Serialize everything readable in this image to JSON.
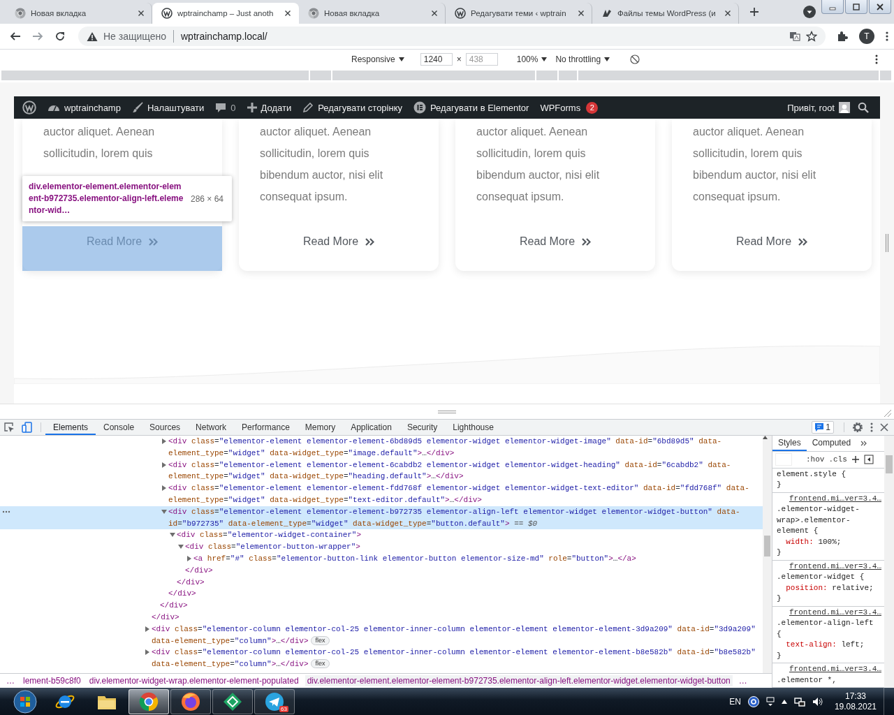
{
  "browser_tabs": [
    {
      "title": "Новая вкладка",
      "kind": "chrome",
      "selected": false
    },
    {
      "title": "wptrainchamp – Just anoth",
      "kind": "wordpress",
      "selected": true
    },
    {
      "title": "Новая вкладка",
      "kind": "chrome",
      "selected": false
    },
    {
      "title": "Редагувати теми ‹ wptrain",
      "kind": "wordpress",
      "selected": false
    },
    {
      "title": "Файлы темы WordPress (и",
      "kind": "quill",
      "selected": false
    }
  ],
  "address_bar": {
    "security": "Не защищено",
    "url": "wptrainchamp.local/",
    "profile": "T"
  },
  "device_toolbar": {
    "mode": "Responsive",
    "width_field": {
      "value": "1240"
    },
    "times": "×",
    "height_field": {
      "placeholder": "438"
    },
    "zoom": "100%",
    "throttling": "No throttling"
  },
  "admin_bar": {
    "items": [
      {
        "kind": "wordpress"
      },
      {
        "kind": "dashboard",
        "label": "wptrainchamp"
      },
      {
        "kind": "brush",
        "label": "Налаштувати"
      },
      {
        "kind": "comment",
        "label": "0"
      },
      {
        "kind": "plus",
        "label": "Додати"
      },
      {
        "kind": "pencil",
        "label": "Редагувати сторінку"
      },
      {
        "kind": "elementor",
        "label": "Редагувати в Elementor"
      },
      {
        "kind": "text",
        "label": "WPForms",
        "badge": "2"
      }
    ],
    "greeting": "Привіт, root"
  },
  "cards": [
    {
      "lines": [
        "auctor aliquet. Aenean",
        "sollicitudin, lorem quis"
      ],
      "button": "Read More",
      "highlighted": true
    },
    {
      "lines": [
        "auctor aliquet. Aenean",
        "sollicitudin, lorem quis",
        "bibendum auctor, nisi elit",
        "consequat ipsum."
      ],
      "button": "Read More",
      "highlighted": false
    },
    {
      "lines": [
        "auctor aliquet. Aenean",
        "sollicitudin, lorem quis",
        "bibendum auctor, nisi elit",
        "consequat ipsum."
      ],
      "button": "Read More",
      "highlighted": false
    },
    {
      "lines": [
        "auctor aliquet. Aenean",
        "sollicitudin, lorem quis",
        "bibendum auctor, nisi elit",
        "consequat ipsum."
      ],
      "button": "Read More",
      "highlighted": false
    }
  ],
  "inspect_tooltip": {
    "selector": "div.elementor-element.elementor-element-b972735.elementor-align-left.elementor-wid…",
    "size": "286 × 64"
  },
  "devtools": {
    "tabs": [
      {
        "label": "Elements",
        "selected": true
      },
      {
        "label": "Console",
        "selected": false
      },
      {
        "label": "Sources",
        "selected": false
      },
      {
        "label": "Network",
        "selected": false
      },
      {
        "label": "Performance",
        "selected": false
      },
      {
        "label": "Memory",
        "selected": false
      },
      {
        "label": "Application",
        "selected": false
      },
      {
        "label": "Security",
        "selected": false
      },
      {
        "label": "Lighthouse",
        "selected": false
      }
    ],
    "issues": "1",
    "dom_tree": [
      {
        "kind": "partial",
        "close": "</div>",
        "children": [
          {
            "kind": "partial",
            "close": "</div>",
            "children": [
              {
                "kind": "element",
                "tag": "<div class=\"elementor-element elementor-element-6bd89d5 elementor-widget elementor-widget-image\" data-id=\"6bd89d5\" data-element_type=\"widget\" data-widget_type=\"image.default\">…</div>",
                "expanded": false,
                "selected": false
              },
              {
                "kind": "element",
                "tag": "<div class=\"elementor-element elementor-element-6cabdb2 elementor-widget elementor-widget-heading\" data-id=\"6cabdb2\" data-element_type=\"widget\" data-widget_type=\"heading.default\">…</div>",
                "expanded": false,
                "selected": false
              },
              {
                "kind": "element",
                "tag": "<div class=\"elementor-element elementor-element-fdd768f elementor-widget elementor-widget-text-editor\" data-id=\"fdd768f\" data-element_type=\"widget\" data-widget_type=\"text-editor.default\">…</div>",
                "expanded": false,
                "selected": false
              },
              {
                "kind": "element",
                "tag": "<div class=\"elementor-element elementor-element-b972735 elementor-align-left elementor-widget elementor-widget-button\" data-id=\"b972735\" data-element_type=\"widget\" data-widget_type=\"button.default\">",
                "suffix": "== $0",
                "expanded": true,
                "selected": true,
                "close": "</div>",
                "children": [
                  {
                    "kind": "element",
                    "tag": "<div class=\"elementor-widget-container\">",
                    "expanded": true,
                    "selected": false,
                    "close": "</div>",
                    "children": [
                      {
                        "kind": "element",
                        "tag": "<div class=\"elementor-button-wrapper\">",
                        "expanded": true,
                        "selected": false,
                        "close": "</div>",
                        "children": [
                          {
                            "kind": "element",
                            "tag": "<a href=\"#\" class=\"elementor-button-link elementor-button elementor-size-md\" role=\"button\">…</a>",
                            "expanded": false,
                            "selected": false
                          }
                        ]
                      }
                    ]
                  }
                ]
              }
            ]
          }
        ]
      },
      {
        "kind": "element",
        "tag": "<div class=\"elementor-column elementor-col-25 elementor-inner-column elementor-element elementor-element-3d9a209\" data-id=\"3d9a209\" data-element_type=\"column\">…</div>",
        "badge": "flex",
        "expanded": false,
        "selected": false
      },
      {
        "kind": "element",
        "tag": "<div class=\"elementor-column elementor-col-25 elementor-inner-column elementor-element elementor-element-b8e582b\" data-id=\"b8e582b\" data-element_type=\"column\">…</div>",
        "badge": "flex",
        "expanded": false,
        "selected": false
      }
    ],
    "breadcrumbs": [
      {
        "label": "…",
        "selected": false
      },
      {
        "label": "lement-b59c8f0",
        "selected": false
      },
      {
        "label": "div.elementor-widget-wrap.elementor-element-populated",
        "selected": false
      },
      {
        "label": "div.elementor-element.elementor-element-b972735.elementor-align-left.elementor-widget.elementor-widget-button",
        "selected": true
      },
      {
        "label": "…",
        "selected": false
      }
    ],
    "styles_tabs": [
      {
        "label": "Styles",
        "selected": true
      },
      {
        "label": "Computed",
        "selected": false
      }
    ],
    "filter": {
      "hov": ":hov",
      "cls": ".cls"
    },
    "rules": [
      {
        "selector": "element.style {",
        "close": "}"
      },
      {
        "source": "frontend.mi…ver=3.4…",
        "selector": ".elementor-widget-wrap>.elementor-element {",
        "declarations": [
          {
            "property": "width:",
            "value": "100%;"
          }
        ],
        "close": "}"
      },
      {
        "source": "frontend.mi…ver=3.4…",
        "selector": ".elementor-widget {",
        "declarations": [
          {
            "property": "position:",
            "value": "relative;"
          }
        ],
        "close": "}"
      },
      {
        "source": "frontend.mi…ver=3.4…",
        "selector": ".elementor-align-left {",
        "declarations": [
          {
            "property": "text-align:",
            "value": "left;"
          }
        ],
        "close": "}"
      },
      {
        "source": "frontend.mi…ver=3.4…",
        "selector": ".elementor *,"
      }
    ]
  },
  "taskbar": {
    "apps": [
      {
        "kind": "internet-explorer",
        "running": false,
        "active": false
      },
      {
        "kind": "folder",
        "running": false,
        "active": false
      },
      {
        "kind": "chrome",
        "running": true,
        "active": true
      },
      {
        "kind": "firefox",
        "running": true,
        "active": false
      },
      {
        "kind": "diamond",
        "running": true,
        "active": false
      },
      {
        "kind": "telegram",
        "running": true,
        "active": false,
        "badge": "63"
      }
    ],
    "language": "EN",
    "time": "17:33",
    "date": "19.08.2021"
  }
}
